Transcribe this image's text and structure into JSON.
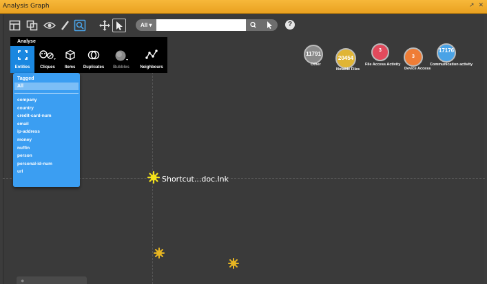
{
  "window": {
    "title": "Analysis Graph",
    "restore_glyph": "↗",
    "close_glyph": "✕"
  },
  "toolbar": {
    "search": {
      "scope_label": "All ▾",
      "value": "",
      "placeholder": ""
    },
    "help_label": "?"
  },
  "analyse": {
    "header": "Analyse",
    "items": [
      {
        "label": "Entities",
        "icon": "entities-icon",
        "active": true
      },
      {
        "label": "Cliques",
        "icon": "cliques-icon"
      },
      {
        "label": "Items",
        "icon": "items-icon"
      },
      {
        "label": "Duplicates",
        "icon": "duplicates-icon"
      },
      {
        "label": "Bubbles",
        "icon": "bubbles-icon",
        "disabled": true
      },
      {
        "label": "Neighbours",
        "icon": "neighbours-icon"
      }
    ]
  },
  "entities_menu": {
    "tagged_label": "Tagged",
    "all_label": "All",
    "types": [
      "company",
      "country",
      "credit-card-num",
      "email",
      "ip-address",
      "money",
      "nuffin",
      "person",
      "personal-id-num",
      "url"
    ]
  },
  "legend": [
    {
      "count": "11791",
      "label": "Other",
      "color": "#8a8a8a"
    },
    {
      "count": "20454",
      "label": "Notable Files",
      "color": "#e0b535"
    },
    {
      "count": "3",
      "label": "File Access Activity",
      "color": "#e24a5c"
    },
    {
      "count": "3",
      "label": "Device Access",
      "color": "#ef7d36"
    },
    {
      "count": "17176",
      "label": "Communication activity",
      "color": "#4aa3e6"
    }
  ],
  "graph": {
    "node_label": "Shortcut...doc.lnk",
    "node_color": "#f4e21a",
    "small_node_color": "#e6b522"
  },
  "minimap_icon": "zoom-icon"
}
